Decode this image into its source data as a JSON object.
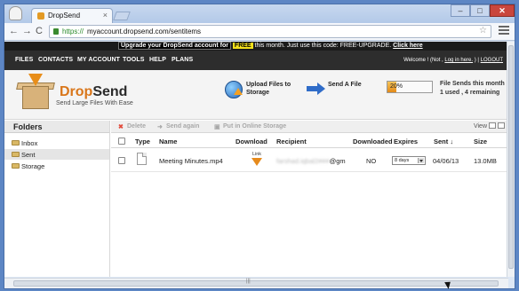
{
  "browser": {
    "tab_title": "DropSend",
    "tab_close": "×",
    "url_scheme": "https://",
    "url_host": "myaccount.dropsend.com/sentitems",
    "back": "←",
    "forward": "→",
    "reload": "C",
    "star": "☆",
    "win_min": "–",
    "win_max": "□",
    "win_close": "✕"
  },
  "promo": {
    "strong": "Upgrade your DropSend account for",
    "free": "FREE",
    "text": " this month. Just use this code: FREE-UPGRADE.",
    "link": "Click here"
  },
  "nav": {
    "items": [
      "FILES",
      "CONTACTS",
      "MY ACCOUNT",
      "TOOLS",
      "HELP",
      "PLANS"
    ],
    "welcome": "Welcome ! (Not ,",
    "login_here": "Log in here.",
    "sep": ") |",
    "logout": "LOGOUT"
  },
  "header": {
    "brand_drop": "Drop",
    "brand_send": "Send",
    "tagline": "Send Large Files With Ease",
    "upload_label": "Upload Files to Storage",
    "send_label": "Send A File",
    "progress_text": "20%",
    "progress_value": 0.2,
    "sends_title": "File Sends this month",
    "sends_info": "1 used , 4 remaining"
  },
  "sidebar": {
    "title": "Folders",
    "items": [
      {
        "label": "Inbox",
        "active": false
      },
      {
        "label": "Sent",
        "active": true
      },
      {
        "label": "Storage",
        "active": false
      }
    ]
  },
  "actions": {
    "delete": "Delete",
    "send_again": "Send again",
    "put_storage": "Put in Online Storage",
    "view": "View"
  },
  "table": {
    "headers": {
      "type": "Type",
      "name": "Name",
      "download": "Download",
      "recipient": "Recipient",
      "downloaded": "Downloaded",
      "expires": "Expires",
      "sent": "Sent ↓",
      "size": "Size"
    },
    "rows": [
      {
        "name": "Meeting Minutes.mp4",
        "download_link": "Link",
        "recipient_blurred": "farshad.iqbal2###",
        "recipient_visible": "@gm",
        "downloaded": "NO",
        "expires": "8 days",
        "sent": "04/06/13",
        "size": "13.0MB"
      }
    ]
  },
  "colors": {
    "accent_orange": "#e68a1c",
    "nav_bg": "#2d2d2d",
    "promo_highlight": "#f5e11b"
  }
}
